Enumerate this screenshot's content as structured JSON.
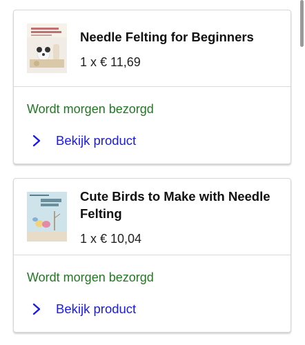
{
  "products": [
    {
      "title": "Needle Felting for Beginners",
      "price_line": "1 x € 11,69",
      "delivery": "Wordt morgen bezorgd",
      "view_label": "Bekijk product",
      "thumb_icon": "book-cover-needle-felting-beginners"
    },
    {
      "title": "Cute Birds to Make with Needle Felting",
      "price_line": "1 x € 10,04",
      "delivery": "Wordt morgen bezorgd",
      "view_label": "Bekijk product",
      "thumb_icon": "book-cover-cute-birds"
    }
  ],
  "colors": {
    "delivery_green": "#207820",
    "link_blue": "#1a1ae6",
    "border": "#d6d6d6"
  }
}
